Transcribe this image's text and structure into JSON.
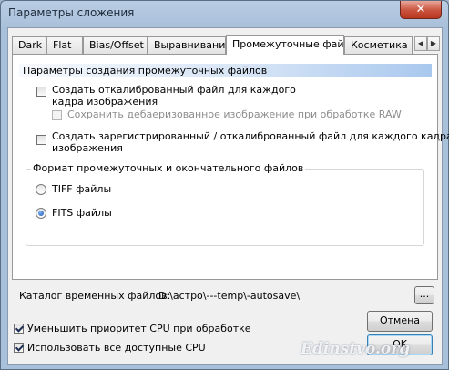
{
  "window": {
    "title": "Параметры сложения",
    "close_glyph": "✕"
  },
  "tabs": [
    {
      "label": "Dark",
      "active": false
    },
    {
      "label": "Flat",
      "active": false
    },
    {
      "label": "Bias/Offset",
      "active": false
    },
    {
      "label": "Выравнивание",
      "active": false
    },
    {
      "label": "Промежуточные файлы",
      "active": true
    },
    {
      "label": "Косметика",
      "active": false
    }
  ],
  "tab_scroll": {
    "left": "◀",
    "right": "▶"
  },
  "panel": {
    "header": "Параметры создания промежуточных файлов",
    "create_calibrated": {
      "line1": "Создать откалиброванный файл для каждого",
      "line2": "кадра изображения",
      "checked": false
    },
    "save_debayered": {
      "label": "Сохранить дебаеризованное изображение при обработке RAW",
      "checked": false,
      "enabled": false
    },
    "create_registered": {
      "line1": "Создать зарегистрированный / откалиброванный файл для каждого кадра",
      "line2": "изображения",
      "checked": false
    },
    "format_group": {
      "title": "Формат промежуточных и окончательного файлов",
      "tiff": {
        "label": "TIFF файлы",
        "selected": false
      },
      "fits": {
        "label": "FITS файлы",
        "selected": true
      }
    }
  },
  "temp_folder": {
    "label": "Каталог временных файлов:",
    "path": "D:\\астро\\---temp\\-autosave\\",
    "browse_label": "..."
  },
  "options": {
    "lower_cpu_priority": {
      "label": "Уменьшить приоритет CPU при обработке",
      "checked": true
    },
    "use_all_cpu": {
      "label": "Использовать все доступные CPU",
      "checked": true
    }
  },
  "buttons": {
    "cancel": "Отмена",
    "ok": "OK"
  },
  "watermark": "Edinstvo.org"
}
